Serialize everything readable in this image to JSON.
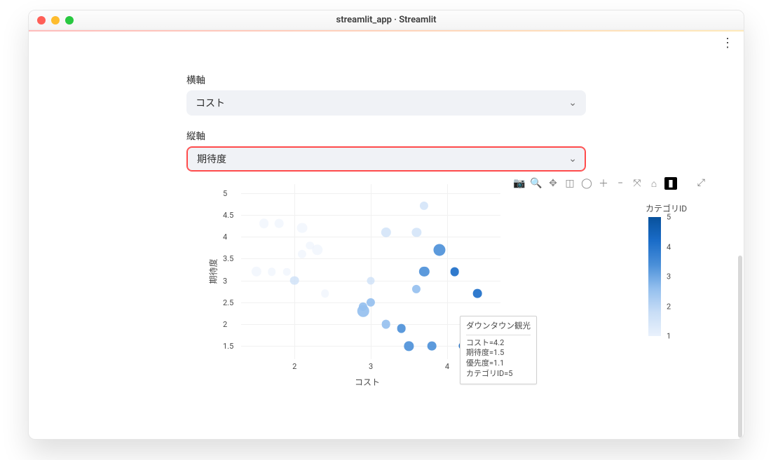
{
  "window": {
    "title": "streamlit_app · Streamlit"
  },
  "controls": {
    "x_label": "横軸",
    "y_label": "縦軸",
    "x_value": "コスト",
    "y_value": "期待度"
  },
  "legend": {
    "title": "カテゴリID",
    "ticks": [
      "5",
      "4",
      "3",
      "2",
      "1"
    ]
  },
  "axes": {
    "x_title": "コスト",
    "y_title": "期待度",
    "x_ticks": [
      "2",
      "3",
      "4"
    ],
    "y_ticks": [
      "1.5",
      "2",
      "2.5",
      "3",
      "3.5",
      "4",
      "4.5",
      "5"
    ]
  },
  "hover": {
    "title": "ダウンタウン観光",
    "lines": [
      "コスト=4.2",
      "期待度=1.5",
      "優先度=1.1",
      "カテゴリID=5"
    ]
  },
  "modebar": [
    "camera",
    "zoom",
    "pan",
    "box-select",
    "lasso",
    "zoom-in",
    "zoom-out",
    "autoscale",
    "reset",
    "hover-compare"
  ],
  "colors": {
    "cat1": "#e9f1fc",
    "cat2": "#c8ddf6",
    "cat3": "#93bfee",
    "cat4": "#4a8fd8",
    "cat5": "#1a6cc8"
  },
  "chart_data": {
    "type": "scatter",
    "xlabel": "コスト",
    "ylabel": "期待度",
    "xlim": [
      1.3,
      4.7
    ],
    "ylim": [
      1.2,
      5.2
    ],
    "size_key": "優先度",
    "color_key": "カテゴリID",
    "points": [
      {
        "x": 1.6,
        "y": 4.3,
        "size": 1.6,
        "cat": 1
      },
      {
        "x": 1.8,
        "y": 4.3,
        "size": 1.4,
        "cat": 1
      },
      {
        "x": 2.1,
        "y": 4.2,
        "size": 1.8,
        "cat": 1
      },
      {
        "x": 2.2,
        "y": 3.8,
        "size": 1.2,
        "cat": 1
      },
      {
        "x": 2.1,
        "y": 3.6,
        "size": 1.3,
        "cat": 1
      },
      {
        "x": 2.3,
        "y": 3.7,
        "size": 1.9,
        "cat": 1
      },
      {
        "x": 1.5,
        "y": 3.2,
        "size": 1.7,
        "cat": 1
      },
      {
        "x": 1.7,
        "y": 3.2,
        "size": 1.2,
        "cat": 1
      },
      {
        "x": 1.9,
        "y": 3.2,
        "size": 1.0,
        "cat": 1
      },
      {
        "x": 2.0,
        "y": 3.0,
        "size": 1.4,
        "cat": 2
      },
      {
        "x": 2.4,
        "y": 2.7,
        "size": 1.2,
        "cat": 1
      },
      {
        "x": 3.2,
        "y": 4.1,
        "size": 1.7,
        "cat": 2
      },
      {
        "x": 3.0,
        "y": 3.0,
        "size": 1.1,
        "cat": 2
      },
      {
        "x": 2.9,
        "y": 2.4,
        "size": 1.3,
        "cat": 3
      },
      {
        "x": 3.0,
        "y": 2.5,
        "size": 1.3,
        "cat": 3
      },
      {
        "x": 2.9,
        "y": 2.3,
        "size": 2.1,
        "cat": 3
      },
      {
        "x": 3.2,
        "y": 2.0,
        "size": 1.4,
        "cat": 3
      },
      {
        "x": 3.4,
        "y": 1.9,
        "size": 1.4,
        "cat": 4
      },
      {
        "x": 3.5,
        "y": 1.5,
        "size": 1.5,
        "cat": 4
      },
      {
        "x": 3.6,
        "y": 4.1,
        "size": 1.5,
        "cat": 2
      },
      {
        "x": 3.7,
        "y": 3.2,
        "size": 1.7,
        "cat": 4
      },
      {
        "x": 3.6,
        "y": 2.8,
        "size": 1.3,
        "cat": 3
      },
      {
        "x": 3.7,
        "y": 4.7,
        "size": 1.3,
        "cat": 2
      },
      {
        "x": 3.8,
        "y": 1.5,
        "size": 1.4,
        "cat": 4
      },
      {
        "x": 3.9,
        "y": 3.7,
        "size": 2.2,
        "cat": 4
      },
      {
        "x": 4.1,
        "y": 3.2,
        "size": 1.4,
        "cat": 5
      },
      {
        "x": 4.4,
        "y": 2.7,
        "size": 1.4,
        "cat": 5
      },
      {
        "x": 4.2,
        "y": 1.5,
        "size": 1.1,
        "cat": 5
      }
    ]
  }
}
